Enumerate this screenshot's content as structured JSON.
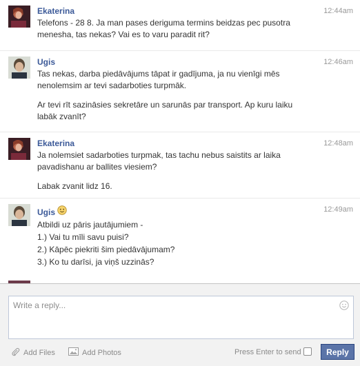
{
  "messages": [
    {
      "sender": "Ekaterina",
      "time": "12:44am",
      "paragraphs": [
        "Telefons - 28         8. Ja man pases deriguma termins beidzas pec pusotra menesha, tas nekas? Vai es to varu paradit rit?"
      ]
    },
    {
      "sender": "Ugis",
      "time": "12:46am",
      "paragraphs": [
        "Tas nekas, darba piedāvājums tāpat ir gadījuma, ja nu vienīgi mēs nenolemsim ar tevi sadarboties turpmāk.",
        "Ar tevi rīt sazināsies sekretāre un sarunās par transport. Ap kuru laiku labāk zvanīt?"
      ]
    },
    {
      "sender": "Ekaterina",
      "time": "12:48am",
      "paragraphs": [
        "Ja nolemsiet sadarboties turpmak, tas tachu nebus saistits ar laika pavadishanu ar ballites viesiem?",
        "Labak zvanit lidz 16."
      ]
    },
    {
      "sender": "Ugis",
      "time": "12:49am",
      "paragraphs": [
        "Atbildi uz pāris jautājumiem -",
        "1.) Vai tu mīli savu puisi?",
        "2.) Kāpēc piekriti šim piedāvājumam?",
        "3.) Ko tu darīsi, ja viņš uzzinās?"
      ]
    }
  ],
  "composer": {
    "placeholder": "Write a reply...",
    "add_files": "Add Files",
    "add_photos": "Add Photos",
    "press_enter": "Press Enter to send",
    "reply": "Reply"
  },
  "icons": {
    "emoji": "smiley-icon",
    "attach": "paperclip-icon",
    "photo": "photo-icon"
  },
  "colors": {
    "sender": "#3b5998",
    "reply_button": "#5b74a8"
  }
}
